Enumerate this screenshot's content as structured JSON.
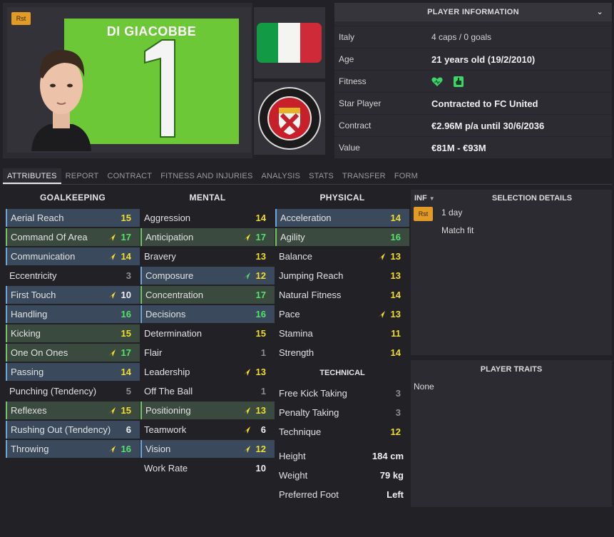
{
  "profile": {
    "role_tag": "Rst",
    "kit_name": "DI GIACOBBE",
    "kit_number": "1",
    "colors": {
      "kit": "#6dc837",
      "flag": [
        "#139a45",
        "#f4f5f0",
        "#cf2a37"
      ]
    }
  },
  "player_information": {
    "title": "PLAYER INFORMATION",
    "rows": [
      {
        "label": "Italy",
        "value": "4 caps / 0 goals"
      },
      {
        "label": "Age",
        "value": "21 years old (19/2/2010)"
      },
      {
        "label": "Fitness",
        "value": ""
      },
      {
        "label": "Star Player",
        "value": "Contracted to FC United"
      },
      {
        "label": "Contract",
        "value": "€2.96M p/a until 30/6/2036"
      },
      {
        "label": "Value",
        "value": "€81M - €93M"
      }
    ]
  },
  "tabs": [
    "ATTRIBUTES",
    "REPORT",
    "CONTRACT",
    "FITNESS AND INJURIES",
    "ANALYSIS",
    "STATS",
    "TRANSFER",
    "FORM"
  ],
  "columns": {
    "goalkeeping": {
      "title": "GOALKEEPING",
      "rows": [
        {
          "name": "Aerial Reach",
          "value": "15"
        },
        {
          "name": "Command Of Area",
          "value": "17"
        },
        {
          "name": "Communication",
          "value": "14"
        },
        {
          "name": "Eccentricity",
          "value": "3"
        },
        {
          "name": "First Touch",
          "value": "10"
        },
        {
          "name": "Handling",
          "value": "16"
        },
        {
          "name": "Kicking",
          "value": "15"
        },
        {
          "name": "One On Ones",
          "value": "17"
        },
        {
          "name": "Passing",
          "value": "14"
        },
        {
          "name": "Punching (Tendency)",
          "value": "5"
        },
        {
          "name": "Reflexes",
          "value": "15"
        },
        {
          "name": "Rushing Out (Tendency)",
          "value": "6"
        },
        {
          "name": "Throwing",
          "value": "16"
        }
      ]
    },
    "mental": {
      "title": "MENTAL",
      "rows": [
        {
          "name": "Aggression",
          "value": "14"
        },
        {
          "name": "Anticipation",
          "value": "17"
        },
        {
          "name": "Bravery",
          "value": "13"
        },
        {
          "name": "Composure",
          "value": "12"
        },
        {
          "name": "Concentration",
          "value": "17"
        },
        {
          "name": "Decisions",
          "value": "16"
        },
        {
          "name": "Determination",
          "value": "15"
        },
        {
          "name": "Flair",
          "value": "1"
        },
        {
          "name": "Leadership",
          "value": "13"
        },
        {
          "name": "Off The Ball",
          "value": "1"
        },
        {
          "name": "Positioning",
          "value": "13"
        },
        {
          "name": "Teamwork",
          "value": "6"
        },
        {
          "name": "Vision",
          "value": "12"
        },
        {
          "name": "Work Rate",
          "value": "10"
        }
      ]
    },
    "physical": {
      "title": "PHYSICAL",
      "rows": [
        {
          "name": "Acceleration",
          "value": "14"
        },
        {
          "name": "Agility",
          "value": "16"
        },
        {
          "name": "Balance",
          "value": "13"
        },
        {
          "name": "Jumping Reach",
          "value": "13"
        },
        {
          "name": "Natural Fitness",
          "value": "14"
        },
        {
          "name": "Pace",
          "value": "13"
        },
        {
          "name": "Stamina",
          "value": "11"
        },
        {
          "name": "Strength",
          "value": "14"
        }
      ]
    },
    "technical": {
      "title": "TECHNICAL",
      "rows": [
        {
          "name": "Free Kick Taking",
          "value": "3"
        },
        {
          "name": "Penalty Taking",
          "value": "3"
        },
        {
          "name": "Technique",
          "value": "12"
        }
      ]
    }
  },
  "bio": [
    {
      "name": "Height",
      "value": "184 cm"
    },
    {
      "name": "Weight",
      "value": "79 kg"
    },
    {
      "name": "Preferred Foot",
      "value": "Left"
    }
  ],
  "selection": {
    "dropdown": "INF",
    "title": "SELECTION DETAILS",
    "tag": "Rst",
    "duration": "1 day",
    "status": "Match fit"
  },
  "traits": {
    "title": "PLAYER TRAITS",
    "value": "None"
  }
}
